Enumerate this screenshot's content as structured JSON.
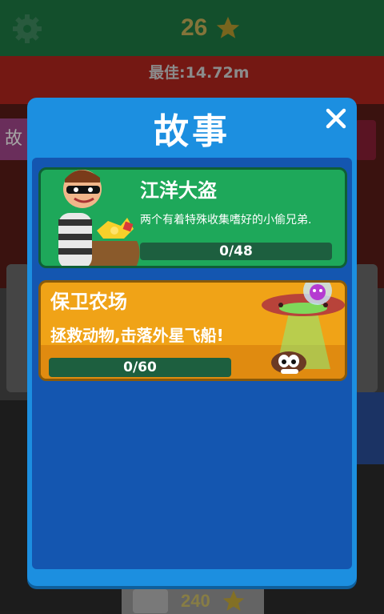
{
  "hud": {
    "score": "26",
    "best_label": "最佳:14.72m",
    "bottom_score": "240"
  },
  "side": {
    "left_tab_label": "故"
  },
  "dialog": {
    "title": "故事",
    "close_icon": "close-icon",
    "stories": [
      {
        "title": "江洋大盗",
        "description": "两个有着特殊收集嗜好的小偷兄弟.",
        "progress_label": "0/48",
        "progress": 0,
        "color": "#1ea85a"
      },
      {
        "title": "保卫农场",
        "description": "拯救动物,击落外星飞船!",
        "progress_label": "0/60",
        "progress": 0,
        "color": "#f0a317"
      }
    ]
  },
  "icons": [
    "gear-icon",
    "star-icon",
    "close-icon",
    "video-icon",
    "thief-illustration",
    "ufo-illustration"
  ],
  "colors": {
    "dialog_bg": "#1c8fe0",
    "dialog_inner": "#1456b0",
    "progress_track": "#1d5f3f"
  }
}
